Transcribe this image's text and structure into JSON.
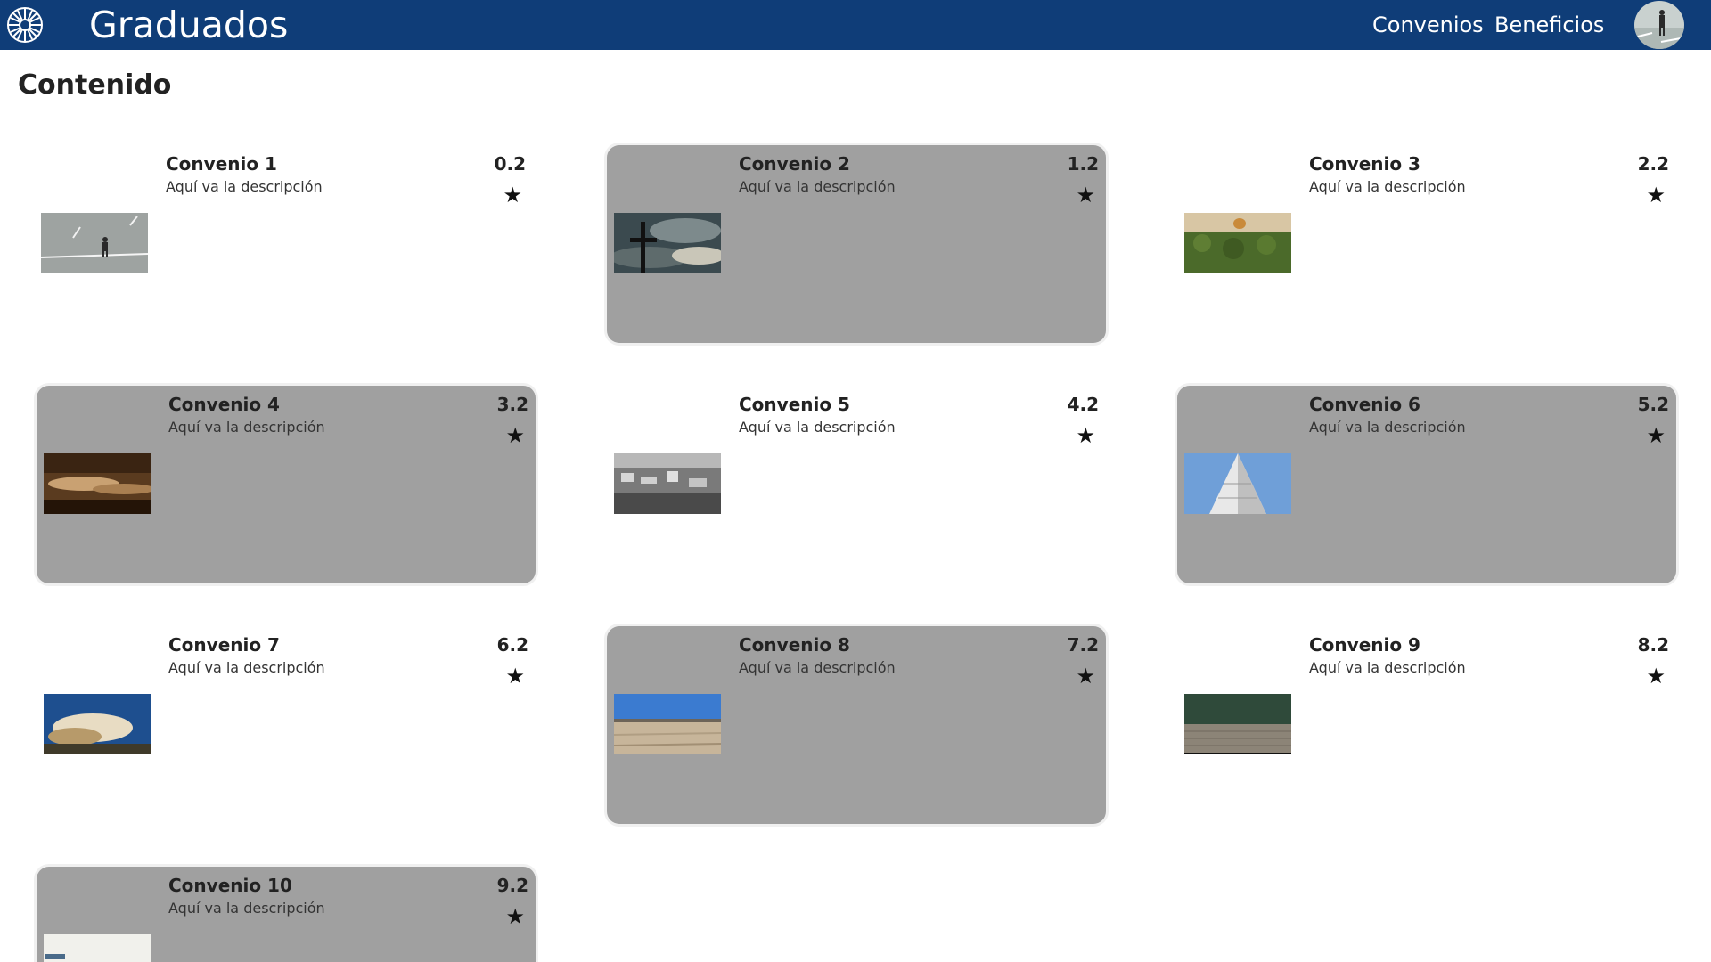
{
  "header": {
    "brand": "Graduados",
    "nav": [
      "Convenios",
      "Beneficios"
    ],
    "bg_color": "#0f3d78"
  },
  "page": {
    "title": "Contenido"
  },
  "cards": [
    {
      "title": "Convenio 1",
      "desc": "Aquí va la descripción",
      "score": "0.2",
      "star": "★",
      "highlighted": false
    },
    {
      "title": "Convenio 2",
      "desc": "Aquí va la descripción",
      "score": "1.2",
      "star": "★",
      "highlighted": true
    },
    {
      "title": "Convenio 3",
      "desc": "Aquí va la descripción",
      "score": "2.2",
      "star": "★",
      "highlighted": false
    },
    {
      "title": "Convenio 4",
      "desc": "Aquí va la descripción",
      "score": "3.2",
      "star": "★",
      "highlighted": true
    },
    {
      "title": "Convenio 5",
      "desc": "Aquí va la descripción",
      "score": "4.2",
      "star": "★",
      "highlighted": false
    },
    {
      "title": "Convenio 6",
      "desc": "Aquí va la descripción",
      "score": "5.2",
      "star": "★",
      "highlighted": true
    },
    {
      "title": "Convenio 7",
      "desc": "Aquí va la descripción",
      "score": "6.2",
      "star": "★",
      "highlighted": false
    },
    {
      "title": "Convenio 8",
      "desc": "Aquí va la descripción",
      "score": "7.2",
      "star": "★",
      "highlighted": true
    },
    {
      "title": "Convenio 9",
      "desc": "Aquí va la descripción",
      "score": "8.2",
      "star": "★",
      "highlighted": false
    },
    {
      "title": "Convenio 10",
      "desc": "Aquí va la descripción",
      "score": "9.2",
      "star": "★",
      "highlighted": true
    }
  ],
  "colors": {
    "card_highlight": "#a0a0a0",
    "text": "#222222"
  }
}
